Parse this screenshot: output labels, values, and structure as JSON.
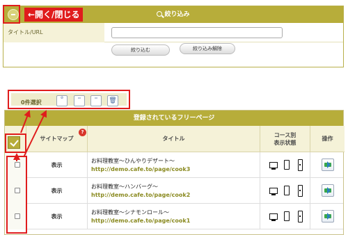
{
  "filter": {
    "title": "絞り込み",
    "label": "タイトル/URL",
    "input_value": "",
    "apply_label": "絞り込む",
    "clear_label": "絞り込み解除"
  },
  "annotation": {
    "toggle_label": "←開く/閉じる"
  },
  "toolbar": {
    "selected_count": "0件選択",
    "icons": [
      "delete-sitemap-icon",
      "add-sitemap-icon",
      "remove-sitemap-icon",
      "trash-icon"
    ]
  },
  "table": {
    "title": "登録されているフリーページ",
    "badge": "?",
    "headers": {
      "sitemap": "サイトマップ",
      "title": "タイトル",
      "course": "コース別\n表示状態",
      "op": "操作"
    },
    "rows": [
      {
        "sitemap": "表示",
        "name": "お料理教室〜ひんやりデザート〜",
        "url": "http://demo.cafe.to/page/cook3"
      },
      {
        "sitemap": "表示",
        "name": "お料理教室〜ハンバーグ〜",
        "url": "http://demo.cafe.to/page/cook2"
      },
      {
        "sitemap": "表示",
        "name": "お料理教室〜シナモンロール〜",
        "url": "http://demo.cafe.to/page/cook1"
      }
    ]
  },
  "colors": {
    "accent": "#b7ad3a",
    "annotation": "#e01c1c",
    "url": "#8a8a20"
  }
}
